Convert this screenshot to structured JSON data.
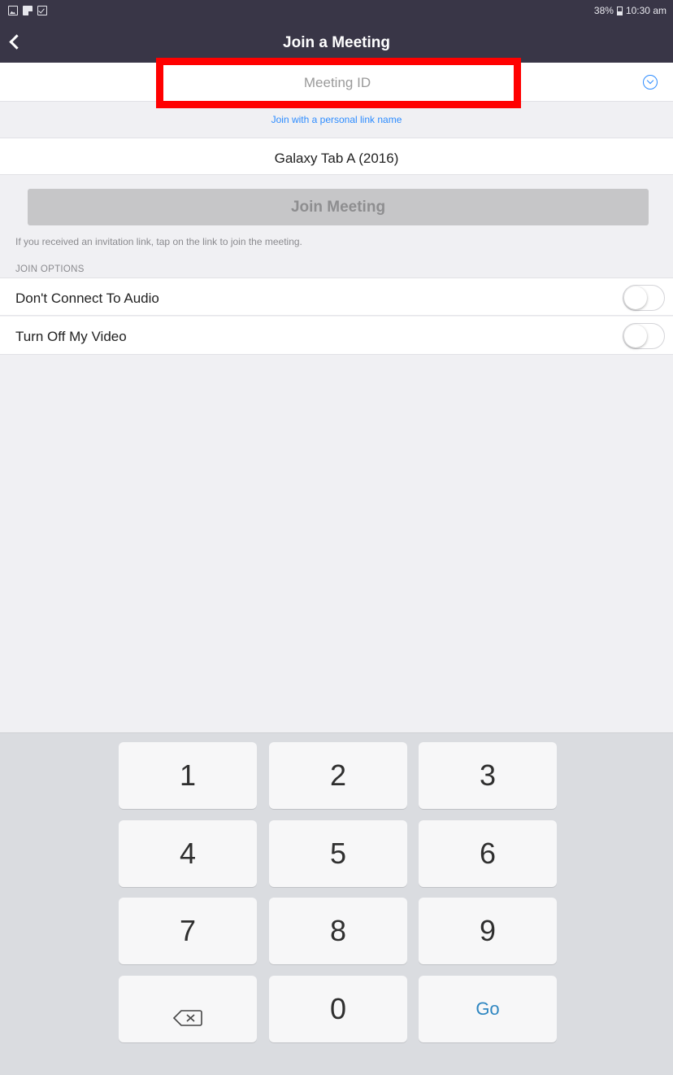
{
  "status_bar": {
    "battery": "38%",
    "time": "10:30 am"
  },
  "nav": {
    "title": "Join a Meeting"
  },
  "meeting_id": {
    "placeholder": "Meeting ID",
    "value": ""
  },
  "personal_link_label": "Join with a personal link name",
  "device_name": "Galaxy Tab A (2016)",
  "join_button_label": "Join Meeting",
  "invitation_hint": "If you received an invitation link, tap on the link to join the meeting.",
  "join_options": {
    "header": "JOIN OPTIONS",
    "items": [
      {
        "label": "Don't Connect To Audio",
        "enabled": false
      },
      {
        "label": "Turn Off My Video",
        "enabled": false
      }
    ]
  },
  "keypad": {
    "keys": [
      "1",
      "2",
      "3",
      "4",
      "5",
      "6",
      "7",
      "8",
      "9",
      "backspace",
      "0",
      "Go"
    ],
    "go_label": "Go"
  },
  "colors": {
    "nav_bg": "#393647",
    "accent": "#2d8cff",
    "highlight": "#ff0000"
  }
}
